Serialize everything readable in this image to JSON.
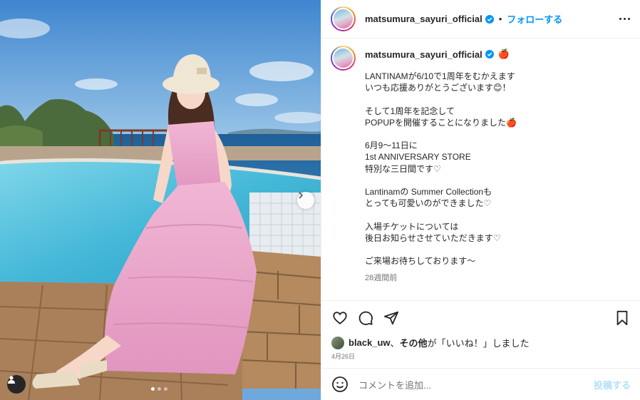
{
  "header": {
    "username": "matsumura_sayuri_official",
    "separator": "•",
    "follow_label": "フォローする"
  },
  "caption": {
    "username": "matsumura_sayuri_official",
    "emoji": "🍎",
    "text": "LANTINAMが6/10で1周年をむかえます\nいつも応援ありがとうございます😊！\n\nそして1周年を記念して\nPOPUPを開催することになりました🍎\n\n6月9～11日に\n1st ANNIVERSARY STORE\n特別な三日間です♡\n\nLantinamの Summer Collectionも\nとっても可愛いのができました♡\n\n入場チケットについては\n後日お知らせさせていただきます♡\n\nご来場お待ちしております～",
    "time_ago": "28週間前"
  },
  "actions": {
    "like_icon": "heart-icon",
    "comment_icon": "comment-icon",
    "share_icon": "paper-plane-icon",
    "save_icon": "bookmark-icon"
  },
  "likes": {
    "user": "black_uw",
    "connector": "、",
    "others": "その他",
    "suffix": "が「いいね！」しました"
  },
  "post_date": "4月26日",
  "comment": {
    "placeholder": "コメントを追加...",
    "post_label": "投稿する",
    "emoji_icon": "smiley-icon"
  },
  "carousel": {
    "total": 3,
    "active": 1
  },
  "colors": {
    "accent": "#0095f6",
    "verified": "#0095f6",
    "disabled_post": "#b2dffc",
    "dress": "#e9a3c8"
  }
}
